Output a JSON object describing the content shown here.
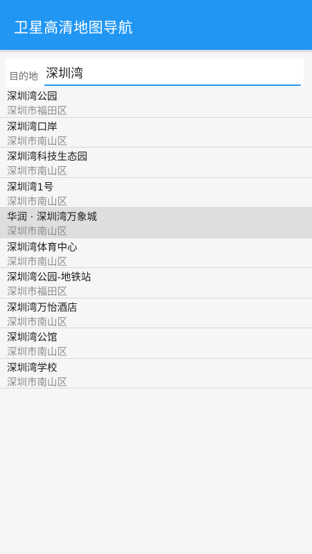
{
  "app": {
    "title": "卫星高清地图导航",
    "accent_color": "#2196f3"
  },
  "search": {
    "label": "目的地",
    "value": "深圳湾"
  },
  "results": [
    {
      "name": "深圳湾公园",
      "area": "深圳市福田区",
      "selected": false
    },
    {
      "name": "深圳湾口岸",
      "area": "深圳市南山区",
      "selected": false
    },
    {
      "name": "深圳湾科技生态园",
      "area": "深圳市南山区",
      "selected": false
    },
    {
      "name": "深圳湾1号",
      "area": "深圳市南山区",
      "selected": false
    },
    {
      "name": "华润 · 深圳湾万象城",
      "area": "深圳市南山区",
      "selected": true
    },
    {
      "name": "深圳湾体育中心",
      "area": "深圳市南山区",
      "selected": false
    },
    {
      "name": "深圳湾公园-地铁站",
      "area": "深圳市福田区",
      "selected": false
    },
    {
      "name": "深圳湾万怡酒店",
      "area": "深圳市南山区",
      "selected": false
    },
    {
      "name": "深圳湾公馆",
      "area": "深圳市南山区",
      "selected": false
    },
    {
      "name": "深圳湾学校",
      "area": "深圳市南山区",
      "selected": false
    }
  ]
}
